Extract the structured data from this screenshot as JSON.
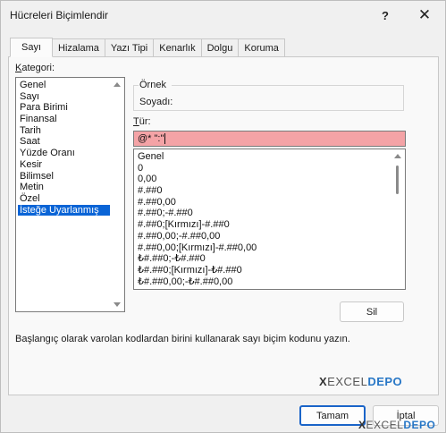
{
  "dialog": {
    "title": "Hücreleri Biçimlendir",
    "help_glyph": "?",
    "close_glyph": "✕"
  },
  "tabs": [
    {
      "label": "Sayı",
      "active": true
    },
    {
      "label": "Hizalama"
    },
    {
      "label": "Yazı Tipi"
    },
    {
      "label": "Kenarlık"
    },
    {
      "label": "Dolgu"
    },
    {
      "label": "Koruma"
    }
  ],
  "category": {
    "label_first": "K",
    "label_rest": "ategori:",
    "items": [
      "Genel",
      "Sayı",
      "Para Birimi",
      "Finansal",
      "Tarih",
      "Saat",
      "Yüzde Oranı",
      "Kesir",
      "Bilimsel",
      "Metin",
      "Özel",
      "İsteğe Uyarlanmış"
    ],
    "selected": "İsteğe Uyarlanmış"
  },
  "sample": {
    "group_label": "Örnek",
    "value": "Soyadı:"
  },
  "type": {
    "label_first": "T",
    "label_rest": "ür:",
    "value": "@* \":\"",
    "field_color": "#f4a3a6",
    "codes": [
      "Genel",
      "0",
      "0,00",
      "#.##0",
      "#.##0,00",
      "#.##0;-#.##0",
      "#.##0;[Kırmızı]-#.##0",
      "#.##0,00;-#.##0,00",
      "#.##0,00;[Kırmızı]-#.##0,00",
      "₺#.##0;-₺#.##0",
      "₺#.##0;[Kırmızı]-₺#.##0",
      "₺#.##0,00;-₺#.##0,00"
    ]
  },
  "buttons": {
    "delete": "Sil",
    "ok": "Tamam",
    "cancel": "İptal"
  },
  "description": "Başlangıç olarak varolan kodlardan birini kullanarak sayı biçim kodunu yazın.",
  "watermark": {
    "x": "X",
    "excel": "EXCEL",
    "depo": "DEPO"
  },
  "colors": {
    "selection": "#0a64d6",
    "default_button_border": "#1a64c8",
    "brand_depo": "#2877c6"
  }
}
